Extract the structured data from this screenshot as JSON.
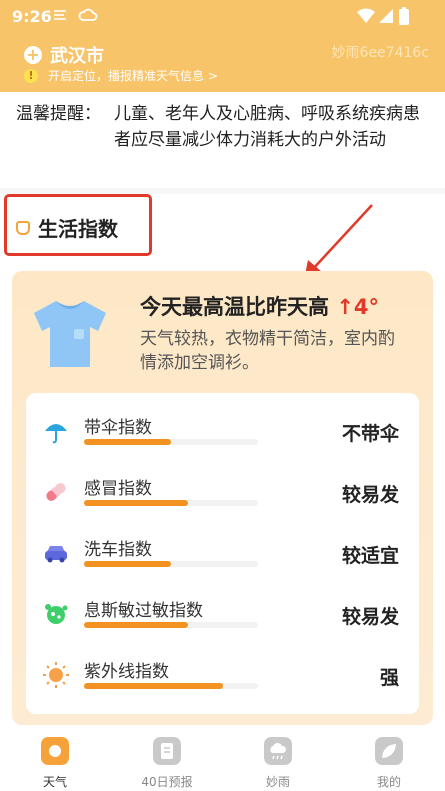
{
  "status_bar": {
    "time": "9:26"
  },
  "header": {
    "city": "武汉市",
    "locate_hint": "开启定位，播报精准天气信息 >",
    "user_id": "妙雨6ee7416c"
  },
  "tip": {
    "label": "温馨提醒：",
    "text": "儿童、老年人及心脏病、呼吸系统疾病患者应尽量减少体力消耗大的户外活动"
  },
  "section": {
    "title": "生活指数"
  },
  "summary": {
    "headline": "今天最高温比昨天高",
    "delta": "↑4°",
    "description": "天气较热，衣物精干简洁，室内酌情添加空调衫。"
  },
  "indices": [
    {
      "name": "带伞指数",
      "value": "不带伞",
      "level": 0.5,
      "icon": "umbrella-icon"
    },
    {
      "name": "感冒指数",
      "value": "较易发",
      "level": 0.6,
      "icon": "pill-icon"
    },
    {
      "name": "洗车指数",
      "value": "较适宜",
      "level": 0.5,
      "icon": "car-icon"
    },
    {
      "name": "息斯敏过敏指数",
      "value": "较易发",
      "level": 0.6,
      "icon": "allergy-icon"
    },
    {
      "name": "紫外线指数",
      "value": "强",
      "level": 0.8,
      "icon": "sun-icon"
    }
  ],
  "tabs": [
    {
      "label": "天气",
      "icon": "weather-icon",
      "active": true
    },
    {
      "label": "40日预报",
      "icon": "forecast-icon",
      "active": false
    },
    {
      "label": "妙雨",
      "icon": "rain-cloud-icon",
      "active": false
    },
    {
      "label": "我的",
      "icon": "profile-leaf-icon",
      "active": false
    }
  ],
  "colors": {
    "accent": "#f8c46a",
    "bar_fill": "#f39220",
    "highlight_red": "#e23a2a"
  }
}
